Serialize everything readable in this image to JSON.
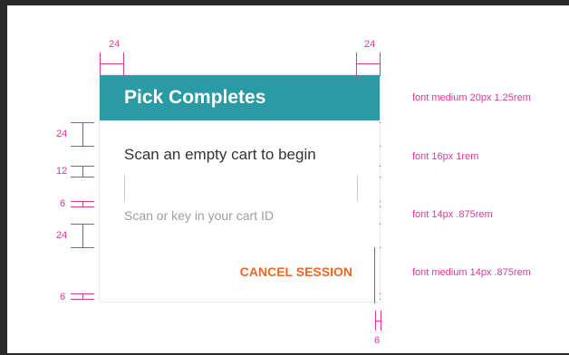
{
  "dialog": {
    "title": "Pick Completes",
    "message": "Scan an empty cart to begin",
    "input_placeholder": "Scan or key in your cart ID",
    "cancel_label": "CANCEL SESSION"
  },
  "annotations": {
    "left_margin": "24",
    "right_margin": "24",
    "spacing_header_message": "24",
    "spacing_message_input": "12",
    "spacing_input_hint": "6",
    "spacing_hint_button": "24",
    "spacing_bottom": "6",
    "spacing_button_right": "6",
    "note_title": "font medium 20px 1.25rem",
    "note_message": "font 16px 1rem",
    "note_input": "font 14px .875rem",
    "note_button": "font medium 14px .875rem"
  },
  "colors": {
    "header": "#2a9aa5",
    "button_text": "#e8682a",
    "redline": "#e0369a"
  }
}
